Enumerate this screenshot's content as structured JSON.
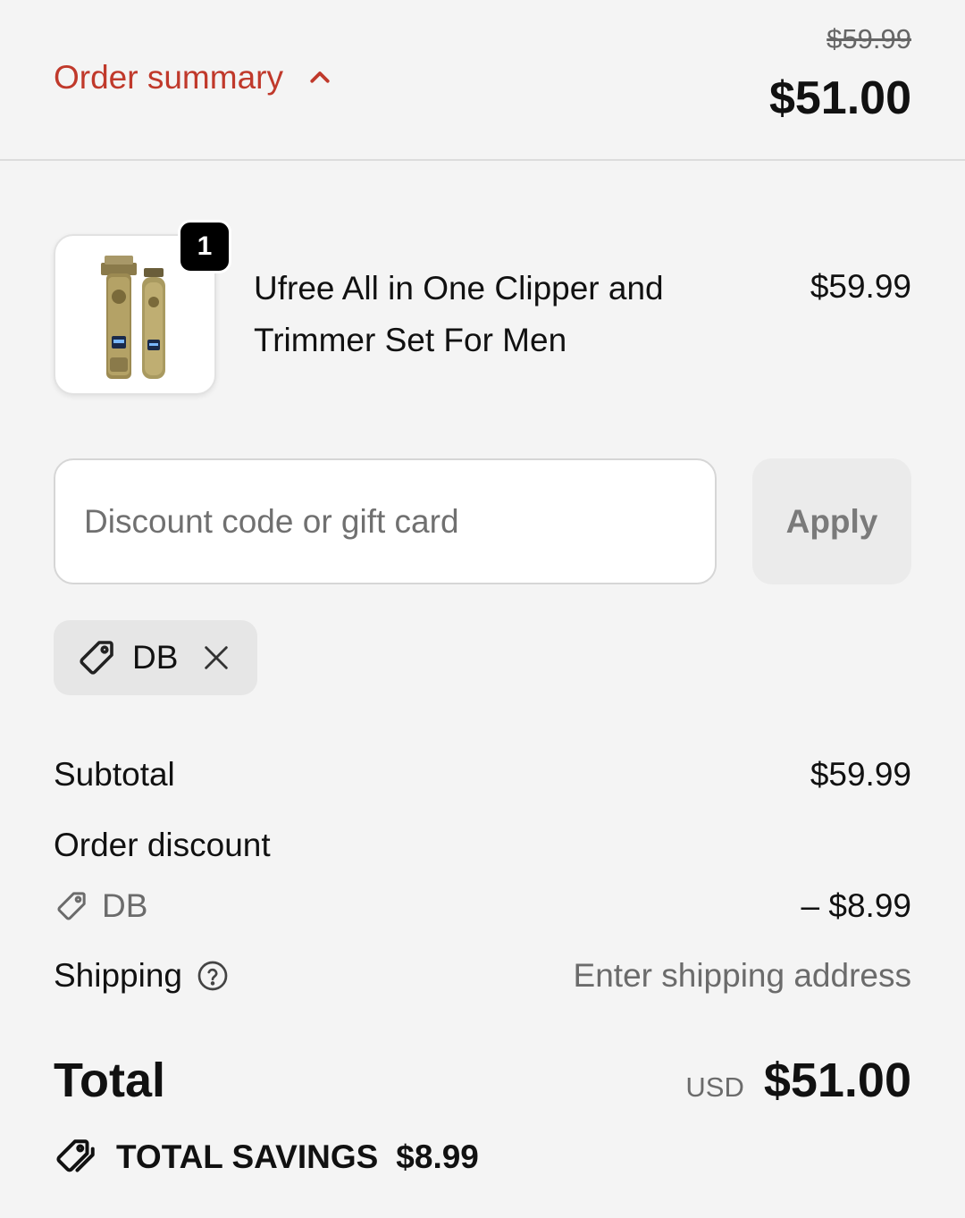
{
  "header": {
    "toggle_label": "Order summary",
    "original_price": "$59.99",
    "total_price": "$51.00"
  },
  "product": {
    "quantity": "1",
    "name": "Ufree All in One Clipper and Trimmer Set For Men",
    "price": "$59.99"
  },
  "discount": {
    "placeholder": "Discount code or gift card",
    "apply_label": "Apply",
    "applied_code": "DB"
  },
  "summary": {
    "subtotal_label": "Subtotal",
    "subtotal_value": "$59.99",
    "order_discount_label": "Order discount",
    "discount_code": "DB",
    "discount_value": "– $8.99",
    "shipping_label": "Shipping",
    "shipping_value": "Enter shipping address",
    "total_label": "Total",
    "currency": "USD",
    "total_value": "$51.00",
    "savings_label": "TOTAL SAVINGS",
    "savings_value": "$8.99"
  },
  "colors": {
    "accent": "#c0392b",
    "background": "#f4f4f4"
  },
  "icons": {
    "toggle": "chevron-up-icon",
    "chip_tag": "tag-icon",
    "chip_remove": "close-icon",
    "shipping_help": "question-circle-icon",
    "savings": "tags-icon"
  }
}
